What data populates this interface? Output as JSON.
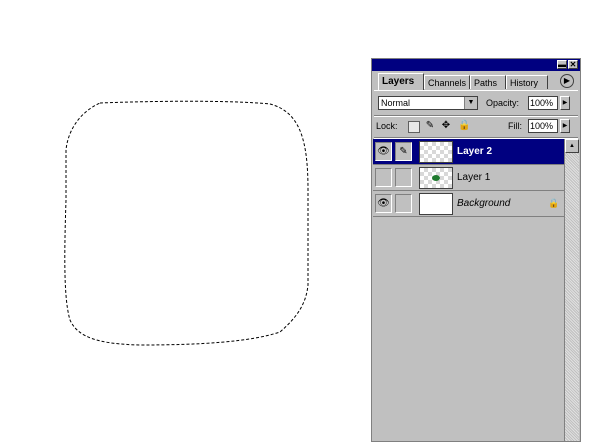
{
  "window": {
    "minimize_glyph": "▬",
    "close_glyph": "✕"
  },
  "tabs": [
    {
      "label": "Layers",
      "active": true
    },
    {
      "label": "Channels",
      "active": false
    },
    {
      "label": "Paths",
      "active": false
    },
    {
      "label": "History",
      "active": false
    }
  ],
  "tab_menu_glyph": "▶",
  "blend": {
    "mode": "Normal",
    "arrow": "▼",
    "opacity_label": "Opacity:",
    "opacity_value": "100%",
    "spin_glyph": "▶"
  },
  "lock": {
    "label": "Lock:",
    "icons": [
      "lock-transparency-icon",
      "lock-image-icon",
      "lock-position-icon",
      "lock-all-icon"
    ],
    "fill_label": "Fill:",
    "fill_value": "100%",
    "spin_glyph": "▶"
  },
  "layers": [
    {
      "name": "Layer 2",
      "visible": true,
      "selected": true,
      "thumbnail": "transparent",
      "brush": true
    },
    {
      "name": "Layer 1",
      "visible": false,
      "selected": false,
      "thumbnail": "green-dot",
      "brush": false
    },
    {
      "name": "Background",
      "visible": true,
      "selected": false,
      "thumbnail": "white",
      "locked": true
    }
  ],
  "scroll_up_glyph": "▲",
  "colors": {
    "titlebar": "#000080",
    "selection_row": "#000080",
    "panel_bg": "#c0c0c0"
  }
}
